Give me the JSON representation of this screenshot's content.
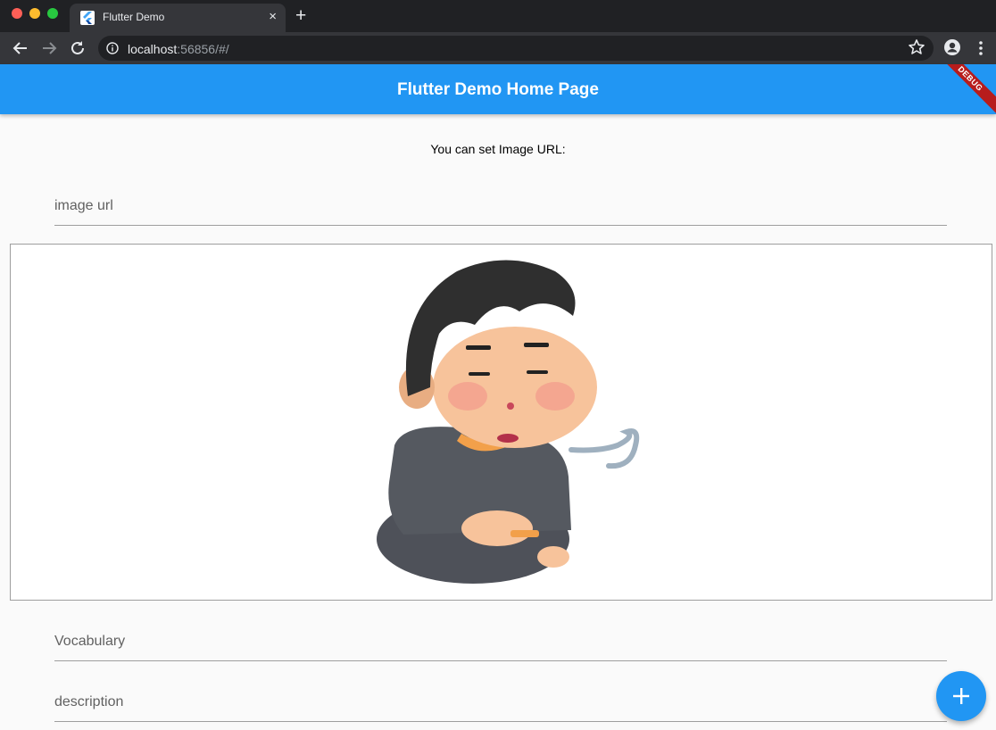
{
  "browser": {
    "tab_title": "Flutter Demo",
    "tab_close": "×",
    "new_tab": "+",
    "url_host": "localhost",
    "url_rest": ":56856/#/"
  },
  "app": {
    "title": "Flutter Demo Home Page",
    "debug_banner": "DEBUG",
    "prompt": "You can set Image URL:",
    "fields": {
      "image_url": "image url",
      "vocabulary": "Vocabulary",
      "description": "description"
    },
    "fab_icon": "plus-icon",
    "image_subject": "illustration"
  },
  "colors": {
    "primary": "#2196f3",
    "debug": "#b71c1c"
  }
}
